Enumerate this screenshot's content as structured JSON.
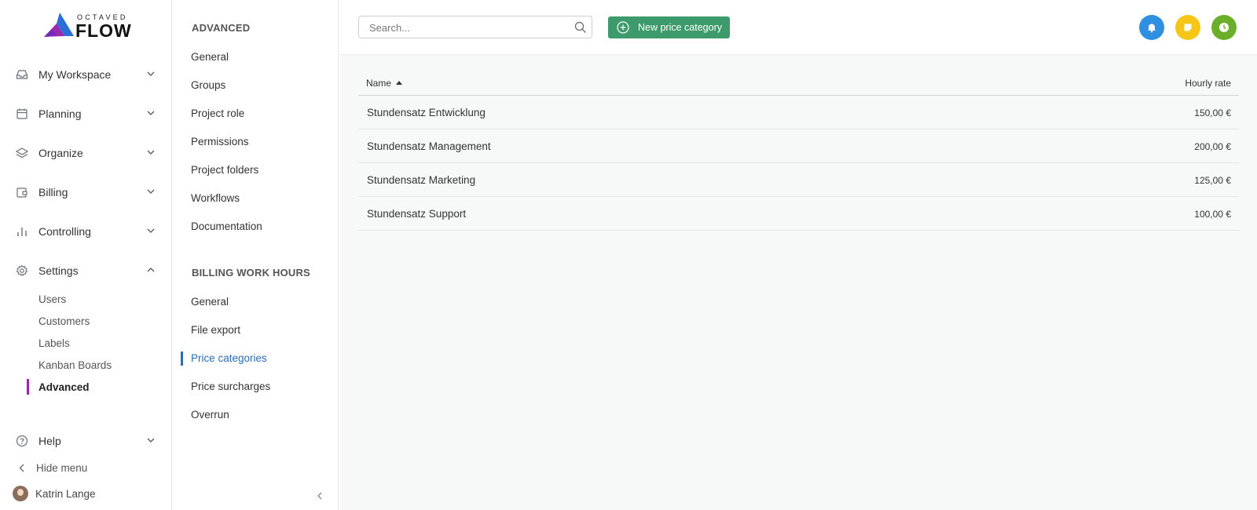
{
  "logo": {
    "top_text": "OCTAVED",
    "main_text": "FLOW"
  },
  "sidebar": {
    "items": [
      {
        "label": "My Workspace",
        "icon": "inbox-icon"
      },
      {
        "label": "Planning",
        "icon": "calendar-icon"
      },
      {
        "label": "Organize",
        "icon": "layers-icon"
      },
      {
        "label": "Billing",
        "icon": "wallet-icon"
      },
      {
        "label": "Controlling",
        "icon": "bar-chart-icon"
      },
      {
        "label": "Settings",
        "icon": "gear-icon"
      }
    ],
    "settings_sub": [
      "Users",
      "Customers",
      "Labels",
      "Kanban Boards",
      "Advanced"
    ],
    "help": "Help",
    "hide_menu": "Hide menu",
    "user_name": "Katrin Lange"
  },
  "settings_menu": {
    "advanced_title": "ADVANCED",
    "advanced_items": [
      "General",
      "Groups",
      "Project role",
      "Permissions",
      "Project folders",
      "Workflows",
      "Documentation"
    ],
    "billing_title": "BILLING WORK HOURS",
    "billing_items": [
      "General",
      "File export",
      "Price categories",
      "Price surcharges",
      "Overrun"
    ],
    "active_item": "Price categories"
  },
  "topbar": {
    "search_placeholder": "Search...",
    "new_button_label": "New price category",
    "action_colors": {
      "notifications": "#2f8fe0",
      "notes": "#f5c518",
      "timer": "#6aae2a"
    }
  },
  "table": {
    "col_name": "Name",
    "col_rate": "Hourly rate",
    "rows": [
      {
        "name": "Stundensatz Entwicklung",
        "rate": "150,00 €"
      },
      {
        "name": "Stundensatz Management",
        "rate": "200,00 €"
      },
      {
        "name": "Stundensatz Marketing",
        "rate": "125,00 €"
      },
      {
        "name": "Stundensatz Support",
        "rate": "100,00 €"
      }
    ]
  }
}
